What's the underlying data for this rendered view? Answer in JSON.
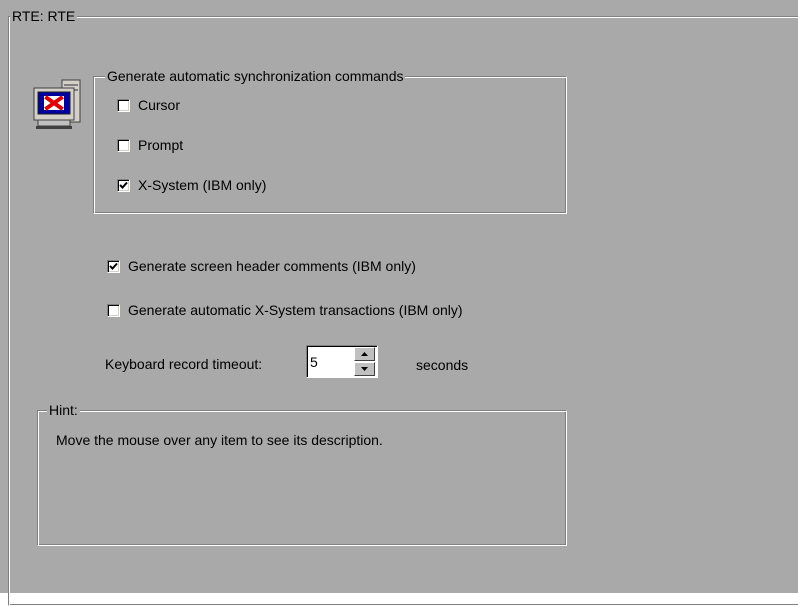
{
  "panel": {
    "title": "RTE: RTE"
  },
  "sync_group": {
    "title": "Generate automatic synchronization commands",
    "options": [
      {
        "label": "Cursor",
        "checked": false
      },
      {
        "label": "Prompt",
        "checked": false
      },
      {
        "label": "X-System (IBM only)",
        "checked": true
      }
    ]
  },
  "options": {
    "screen_header": {
      "label": "Generate screen header comments (IBM only)",
      "checked": true
    },
    "xsystem_transactions": {
      "label": "Generate automatic X-System transactions (IBM only)",
      "checked": false
    }
  },
  "keyboard_timeout": {
    "label": "Keyboard record timeout:",
    "value": "5",
    "unit": "seconds"
  },
  "hint": {
    "title": "Hint:",
    "text": "Move the mouse over any item to see its description."
  },
  "icons": {
    "terminal": "terminal-x-icon"
  },
  "colors": {
    "panel_bg": "#a9a9a9",
    "icon_x_red": "#e00000",
    "icon_screen_blue": "#0000a0"
  }
}
